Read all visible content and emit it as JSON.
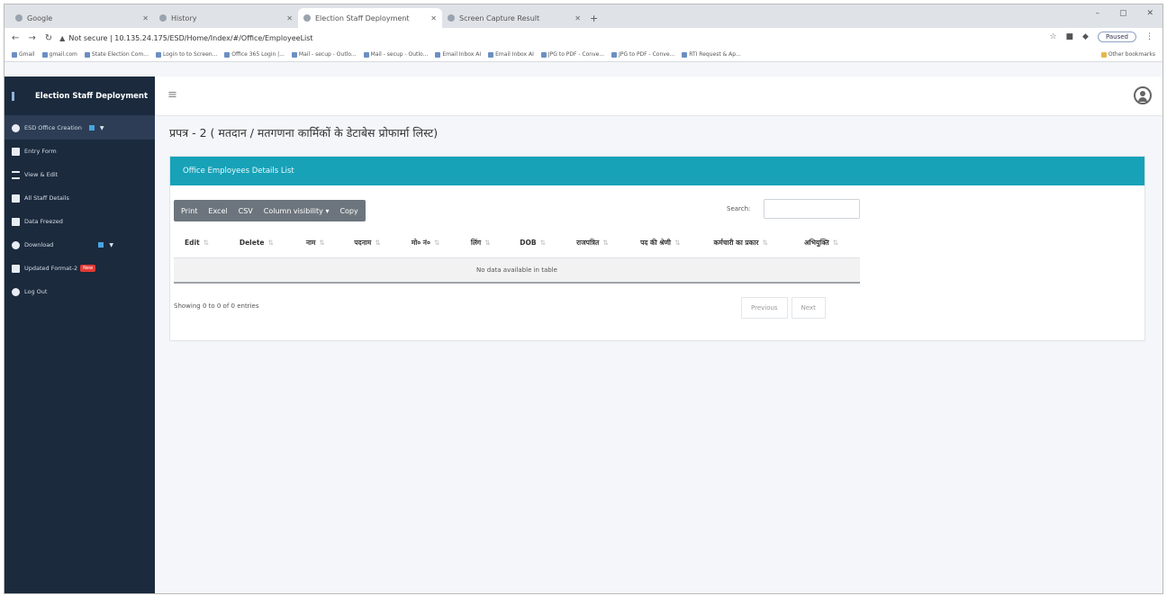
{
  "browser": {
    "tabs": [
      {
        "title": "Google",
        "active": false
      },
      {
        "title": "History",
        "active": false
      },
      {
        "title": "Election Staff Deployment",
        "active": true
      },
      {
        "title": "Screen Capture Result",
        "active": false
      }
    ],
    "new_tab": "+",
    "window_controls": [
      "–",
      "▢",
      "✕"
    ],
    "url": "Not secure | 10.135.24.175/ESD/Home/Index/#/Office/EmployeeList",
    "profile_status": "Paused",
    "bookmarks": [
      "Gmail",
      "gmail.com",
      "State Election Com...",
      "Login to to Screen...",
      "Office 365 Login |...",
      "Mail - secup - Outlo...",
      "Mail - secup - Outlo...",
      "Email Inbox AI",
      "Email Inbox AI",
      "JPG to PDF - Conve...",
      "JPG to PDF - Conve...",
      "RTI Request & Ap..."
    ],
    "other_bookmarks": "Other bookmarks"
  },
  "app": {
    "brand": "Election Staff Deployment",
    "menu": [
      {
        "label": "ESD Office Creation",
        "active": true,
        "badge": true,
        "caret": true
      },
      {
        "label": "Entry Form"
      },
      {
        "label": "View & Edit"
      },
      {
        "label": "All Staff Details"
      },
      {
        "label": "Data Freezed"
      },
      {
        "label": "Download",
        "badge": true,
        "caret": true
      },
      {
        "label": "Updated Format-2",
        "new": "New"
      },
      {
        "label": "Log Out"
      }
    ]
  },
  "page": {
    "title": "प्रपत्र - 2 ( मतदान / मतगणना कार्मिकों के डेटाबेस प्रोफार्मा लिस्ट)",
    "card_header": "Office Employees Details List",
    "buttons": {
      "print": "Print",
      "excel": "Excel",
      "csv": "CSV",
      "column_visibility": "Column visibility ▾",
      "copy": "Copy"
    },
    "search_label": "Search:",
    "columns": [
      "Edit",
      "Delete",
      "नाम",
      "पदनाम",
      "मो० नं०",
      "लिंग",
      "DOB",
      "राजपत्रित",
      "पद की श्रेणी",
      "कर्मचारी का प्रकार",
      "अभियुक्ति"
    ],
    "empty_text": "No data available in table",
    "info": "Showing 0 to 0 of 0 entries",
    "pager": {
      "previous": "Previous",
      "next": "Next"
    }
  }
}
